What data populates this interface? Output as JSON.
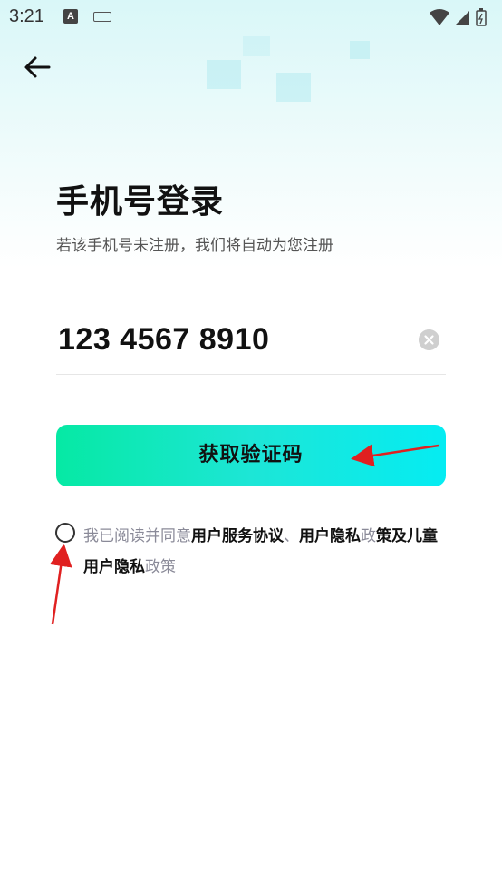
{
  "status_bar": {
    "time": "3:21",
    "a_icon": "A"
  },
  "header": {
    "title": "手机号登录",
    "subtitle": "若该手机号未注册，我们将自动为您注册"
  },
  "phone_input": {
    "value": "123 4567 8910"
  },
  "button": {
    "label": "获取验证码"
  },
  "agreement": {
    "prefix": "我已阅读并同意",
    "terms": "用户服务协议",
    "sep": "、",
    "privacy_a": "用户隐私",
    "policy_a": "政",
    "policy_b": "策",
    "and": "及",
    "child_a": "儿童用户隐私",
    "child_b": "政策"
  },
  "colors": {
    "button_start": "#06e9a4",
    "button_end": "#05ecf2",
    "annotation_arrow": "#e02020"
  }
}
